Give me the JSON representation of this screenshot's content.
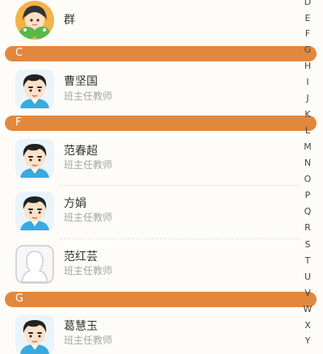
{
  "contacts": {
    "group": {
      "label": "群"
    },
    "sections": [
      {
        "letter": "C",
        "entries": [
          {
            "name": "曹坚国",
            "role": "班主任教师"
          }
        ]
      },
      {
        "letter": "F",
        "entries": [
          {
            "name": "范春超",
            "role": "班主任教师"
          },
          {
            "name": "方娟",
            "role": "班主任教师"
          },
          {
            "name": "范红芸",
            "role": "班主任教师"
          }
        ]
      },
      {
        "letter": "G",
        "entries": [
          {
            "name": "葛慧玉",
            "role": "班主任教师"
          }
        ]
      }
    ]
  },
  "index": {
    "letters": [
      "D",
      "E",
      "F",
      "G",
      "H",
      "I",
      "J",
      "K",
      "L",
      "M",
      "N",
      "O",
      "P",
      "Q",
      "R",
      "S",
      "T",
      "U",
      "V",
      "W",
      "X",
      "Y"
    ]
  },
  "colors": {
    "section": "#e2883e",
    "background": "#fdfcf8"
  }
}
